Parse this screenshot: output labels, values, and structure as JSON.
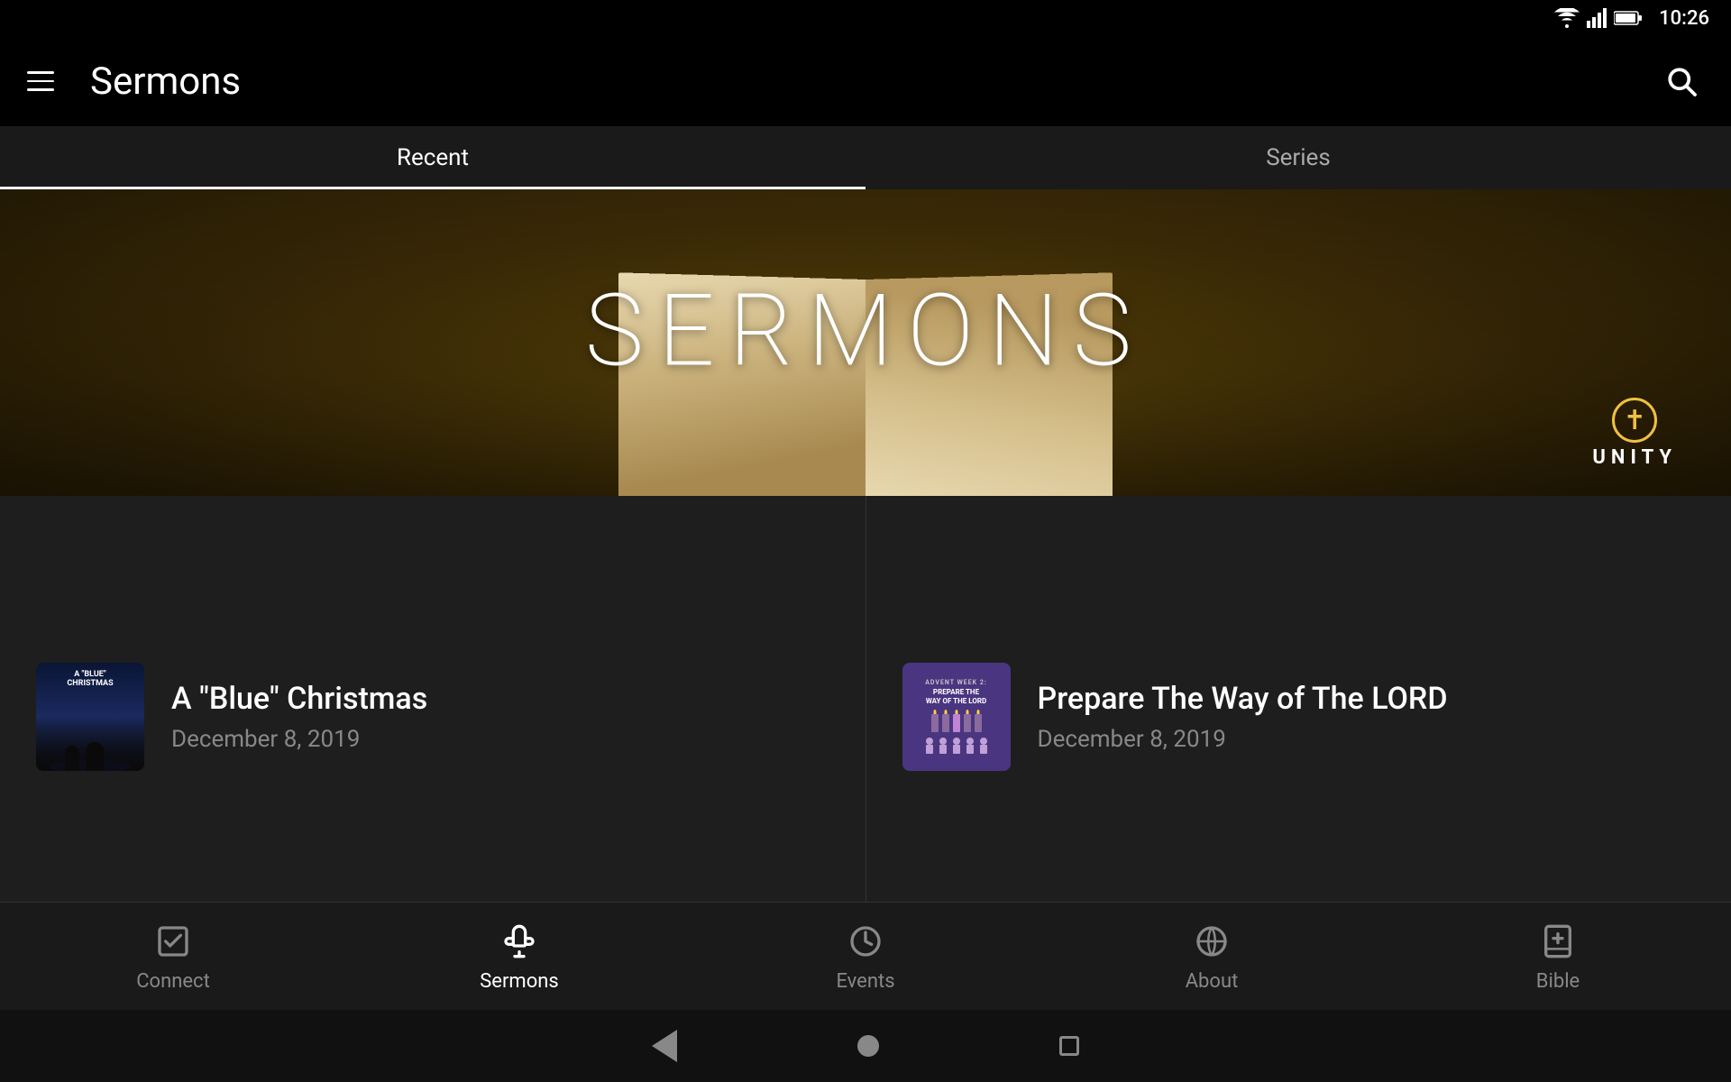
{
  "statusBar": {
    "time": "10:26"
  },
  "appBar": {
    "title": "Sermons"
  },
  "tabs": {
    "items": [
      {
        "label": "Recent",
        "active": true
      },
      {
        "label": "Series",
        "active": false
      }
    ]
  },
  "heroBanner": {
    "title": "SERMONS",
    "logoText": "UNITY"
  },
  "sermons": [
    {
      "title": "A \"Blue\" Christmas",
      "date": "December 8, 2019",
      "thumbType": "blue-xmas",
      "thumbLabel": "A \"BLUE\" CHRISTMAS"
    },
    {
      "title": "Prepare The Way of The LORD",
      "date": "December 8, 2019",
      "thumbType": "advent",
      "thumbTopLabel": "ADVENT WEEK 2:",
      "thumbTitle": "PREPARE THE WAY OF THE LORD"
    }
  ],
  "bottomNav": {
    "items": [
      {
        "label": "Connect",
        "icon": "check-square",
        "active": false
      },
      {
        "label": "Sermons",
        "icon": "microphone",
        "active": true
      },
      {
        "label": "Events",
        "icon": "clock",
        "active": false
      },
      {
        "label": "About",
        "icon": "globe",
        "active": false
      },
      {
        "label": "Bible",
        "icon": "book-cross",
        "active": false
      }
    ]
  }
}
